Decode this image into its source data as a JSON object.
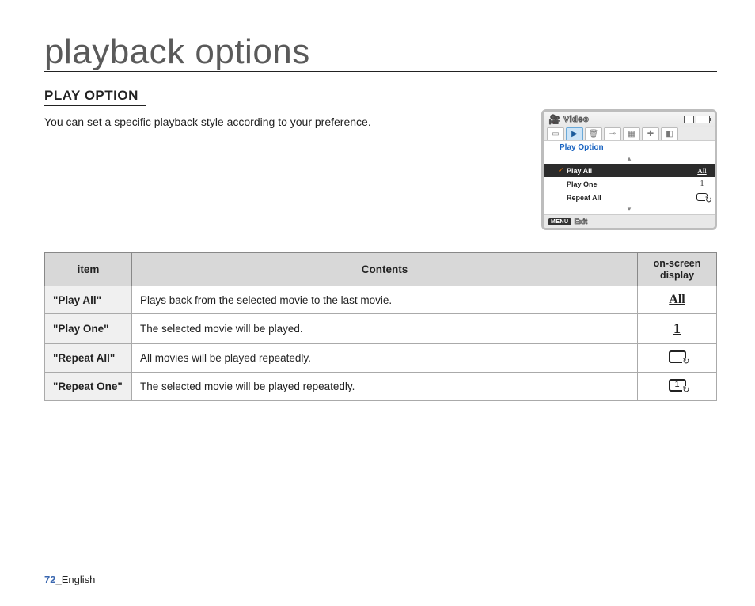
{
  "page_title": "playback options",
  "section_title": "PLAY OPTION",
  "intro": "You can set a specific playback style according to your preference.",
  "osd": {
    "title": "Video",
    "menu_title": "Play Option",
    "items": [
      {
        "label": "Play All",
        "selected": true
      },
      {
        "label": "Play One",
        "selected": false
      },
      {
        "label": "Repeat All",
        "selected": false
      }
    ],
    "footer_menu": "MENU",
    "footer_exit": "Exit"
  },
  "table": {
    "headers": {
      "item": "item",
      "contents": "Contents",
      "osd": "on-screen display"
    },
    "rows": [
      {
        "item": "\"Play All\"",
        "contents": "Plays back from the selected movie to the last movie.",
        "icon": "all"
      },
      {
        "item": "\"Play One\"",
        "contents": "The selected movie will be played.",
        "icon": "one"
      },
      {
        "item": "\"Repeat All\"",
        "contents": "All movies will be played repeatedly.",
        "icon": "repeat-all"
      },
      {
        "item": "\"Repeat One\"",
        "contents": "The selected movie will be played repeatedly.",
        "icon": "repeat-one"
      }
    ]
  },
  "footer": {
    "page_number": "72",
    "sep": "_",
    "lang": "English"
  }
}
